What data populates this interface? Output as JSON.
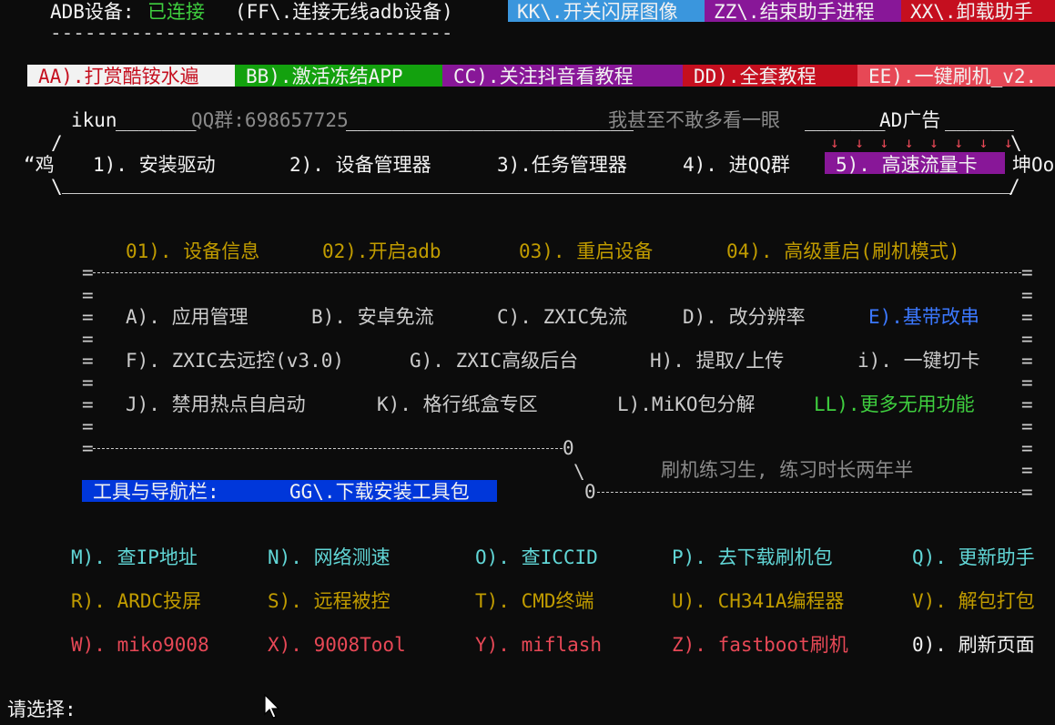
{
  "header": {
    "adb_label": "ADB设备:",
    "adb_status": "已连接",
    "wireless_hint": "(FF\\.连接无线adb设备)",
    "underline": "----------------------------------------"
  },
  "top_buttons": [
    {
      "label": "KK\\.开关闪屏图像",
      "bg": "#3a96dd",
      "fg": "#f2f2f2"
    },
    {
      "label": "ZZ\\.结束助手进程",
      "bg": "#881798",
      "fg": "#f2f2f2"
    },
    {
      "label": "XX\\.卸载助手",
      "bg": "#c50f1f",
      "fg": "#f2f2f2"
    }
  ],
  "row2_buttons": [
    {
      "label": "AA).打赏酷铵水遍",
      "bg": "#f2f2f2",
      "fg": "#c50f1f"
    },
    {
      "label": "BB).激活冻结APP",
      "bg": "#13a10e",
      "fg": "#f2f2f2"
    },
    {
      "label": "CC).关注抖音看教程",
      "bg": "#881798",
      "fg": "#f2f2f2"
    },
    {
      "label": "DD).全套教程",
      "bg": "#c50f1f",
      "fg": "#f2f2f2"
    },
    {
      "label": "EE).一键刷机_v2.",
      "bg": "#e74856",
      "fg": "#f2f2f2"
    }
  ],
  "banner": {
    "ikun": "ikun",
    "qq_group": "QQ群:698657725",
    "slogan": "我甚至不敢多看一眼",
    "ad": "AD广告",
    "left_text": "“鸡",
    "right_text": "坤Oo",
    "arrows": "↓ ↓ ↓ ↓ ↓ ↓ ↓ ↓",
    "items": [
      {
        "label": "1). 安装驱动"
      },
      {
        "label": "2). 设备管理器"
      },
      {
        "label": "3).任务管理器"
      },
      {
        "label": "4). 进QQ群"
      }
    ],
    "highlight_item": "5). 高速流量卡"
  },
  "primary_menu": [
    "01). 设备信息",
    "02).开启adb",
    "03). 重启设备",
    "04). 高级重启(刷机模式)"
  ],
  "grid_rows": [
    [
      {
        "label": "A). 应用管理",
        "color": "#cccccc"
      },
      {
        "label": "B). 安卓免流",
        "color": "#cccccc"
      },
      {
        "label": "C). ZXIC免流",
        "color": "#cccccc"
      },
      {
        "label": "D). 改分辨率",
        "color": "#cccccc"
      },
      {
        "label": "E).基带改串",
        "color": "#3b78ff"
      }
    ],
    [
      {
        "label": "F). ZXIC去远控(v3.0)",
        "color": "#cccccc"
      },
      {
        "label": "G). ZXIC高级后台",
        "color": "#cccccc"
      },
      {
        "label": "H). 提取/上传",
        "color": "#cccccc"
      },
      {
        "label": "i). 一键切卡",
        "color": "#cccccc"
      }
    ],
    [
      {
        "label": "J). 禁用热点自启动",
        "color": "#cccccc"
      },
      {
        "label": "K). 格行纸盒专区",
        "color": "#cccccc"
      },
      {
        "label": "L).MiKO包分解",
        "color": "#cccccc"
      },
      {
        "label": "LL).更多无用功能",
        "color": "#3fcf3f"
      }
    ]
  ],
  "trainee_text": "刷机练习生, 练习时长两年半",
  "tools_bar": {
    "label": "工具与导航栏:",
    "link": "GG\\.下载安装工具包"
  },
  "bottom_rows": [
    [
      {
        "label": "M). 查IP地址",
        "color": "#61d6d6"
      },
      {
        "label": "N). 网络测速",
        "color": "#61d6d6"
      },
      {
        "label": "O). 查ICCID",
        "color": "#61d6d6"
      },
      {
        "label": "P). 去下载刷机包",
        "color": "#61d6d6"
      },
      {
        "label": "Q). 更新助手",
        "color": "#61d6d6"
      }
    ],
    [
      {
        "label": "R). ARDC投屏",
        "color": "#c19c00"
      },
      {
        "label": "S). 远程被控",
        "color": "#c19c00"
      },
      {
        "label": "T). CMD终端",
        "color": "#c19c00"
      },
      {
        "label": "U). CH341A编程器",
        "color": "#c19c00"
      },
      {
        "label": "V). 解包打包",
        "color": "#c19c00"
      }
    ],
    [
      {
        "label": "W). miko9008",
        "color": "#e74856"
      },
      {
        "label": "X). 9008Tool",
        "color": "#e74856"
      },
      {
        "label": "Y). miflash",
        "color": "#e74856"
      },
      {
        "label": "Z). fastboot刷机",
        "color": "#e74856"
      },
      {
        "label": "0). 刷新页面",
        "color": "#f2f2f2"
      }
    ]
  ],
  "prompt": "请选择:"
}
